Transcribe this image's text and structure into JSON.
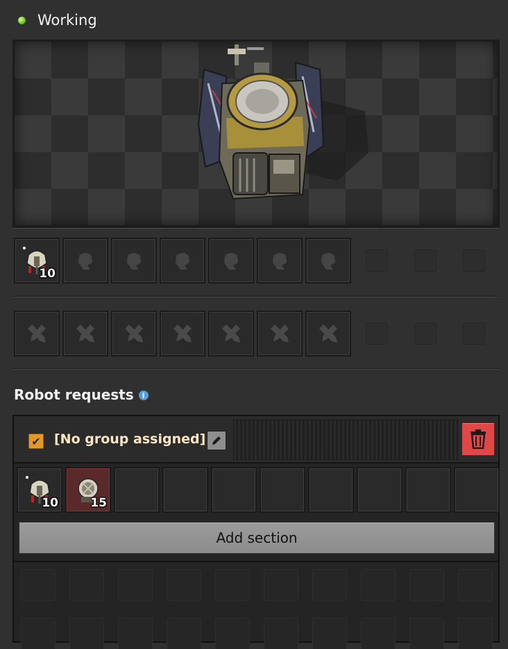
{
  "status": {
    "label": "Working",
    "color": "#7ed321"
  },
  "preview": {
    "entity": "roboport-image"
  },
  "robot_slots": {
    "items": [
      {
        "icon": "construction-robot-icon",
        "count": "10"
      },
      {
        "icon": "robot-ghost-icon"
      },
      {
        "icon": "robot-ghost-icon"
      },
      {
        "icon": "robot-ghost-icon"
      },
      {
        "icon": "robot-ghost-icon"
      },
      {
        "icon": "robot-ghost-icon"
      },
      {
        "icon": "robot-ghost-icon"
      }
    ]
  },
  "repair_slots": {
    "items": [
      {
        "icon": "repair-pack-ghost-icon"
      },
      {
        "icon": "repair-pack-ghost-icon"
      },
      {
        "icon": "repair-pack-ghost-icon"
      },
      {
        "icon": "repair-pack-ghost-icon"
      },
      {
        "icon": "repair-pack-ghost-icon"
      },
      {
        "icon": "repair-pack-ghost-icon"
      },
      {
        "icon": "repair-pack-ghost-icon"
      }
    ]
  },
  "robot_requests": {
    "title": "Robot requests",
    "info_icon": "i",
    "group": {
      "label": "[No group assigned]",
      "checked": true,
      "check_mark": "✔"
    },
    "requests": [
      {
        "icon": "construction-robot-icon",
        "count": "10"
      },
      {
        "icon": "logistic-robot-icon",
        "count": "15"
      }
    ],
    "add_section_label": "Add section"
  },
  "colors": {
    "checkbox": "#e39827",
    "delete": "#e04848",
    "group_label": "#ffe6c0"
  }
}
